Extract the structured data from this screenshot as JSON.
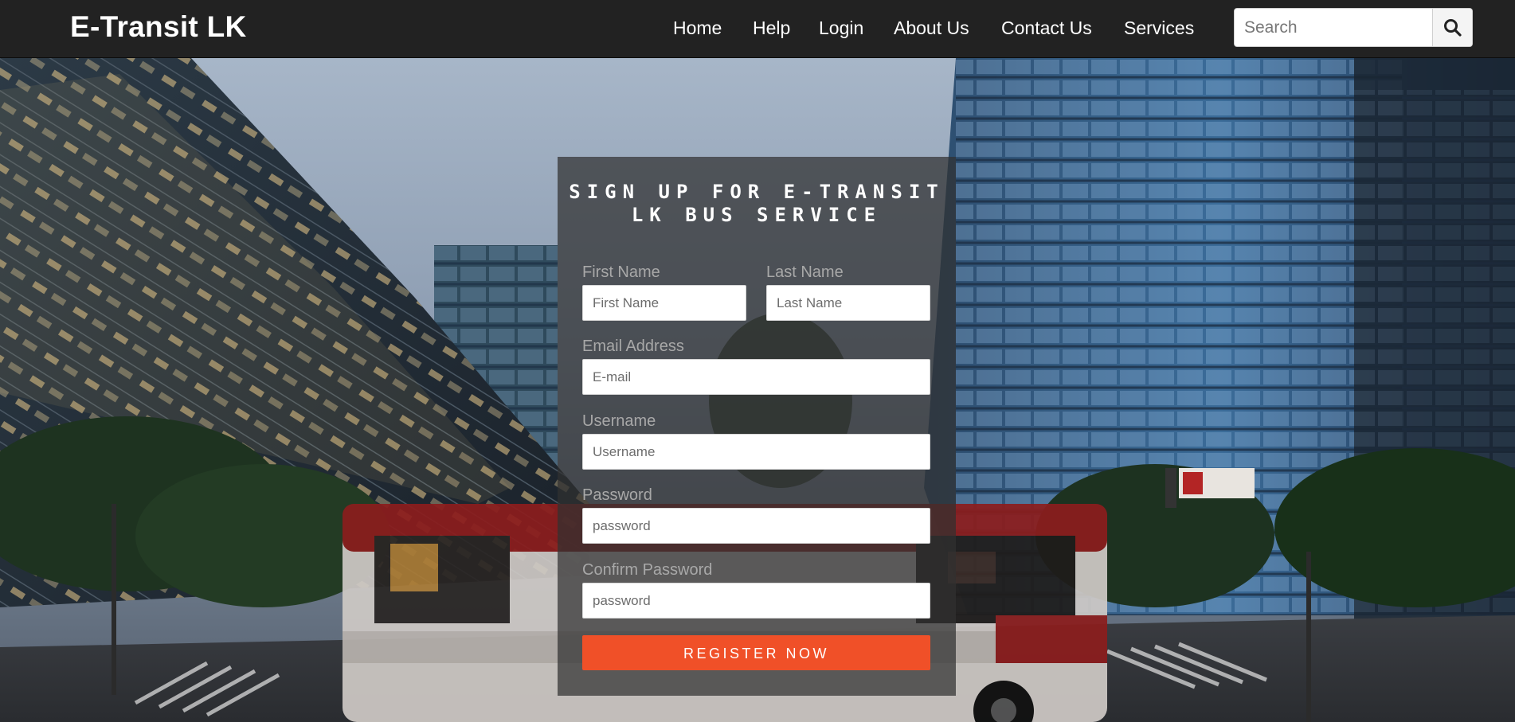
{
  "brand": "E-Transit LK",
  "nav": {
    "home": "Home",
    "help": "Help",
    "login": "Login",
    "about": "About Us",
    "contact": "Contact Us",
    "services": "Services"
  },
  "search": {
    "placeholder": "Search",
    "icon": "search-icon"
  },
  "form": {
    "title_line1": "SIGN UP FOR E-TRANSIT",
    "title_line2": "LK BUS SERVICE",
    "first_name": {
      "label": "First Name",
      "placeholder": "First Name"
    },
    "last_name": {
      "label": "Last Name",
      "placeholder": "Last Name"
    },
    "email": {
      "label": "Email Address",
      "placeholder": "E-mail"
    },
    "username": {
      "label": "Username",
      "placeholder": "Username"
    },
    "password": {
      "label": "Password",
      "placeholder": "password"
    },
    "confirm_password": {
      "label": "Confirm Password",
      "placeholder": "password"
    },
    "register_label": "REGISTER NOW"
  },
  "colors": {
    "navbar": "#222222",
    "accent": "#f05028",
    "panel": "#303030",
    "label": "#a8a8a8"
  }
}
